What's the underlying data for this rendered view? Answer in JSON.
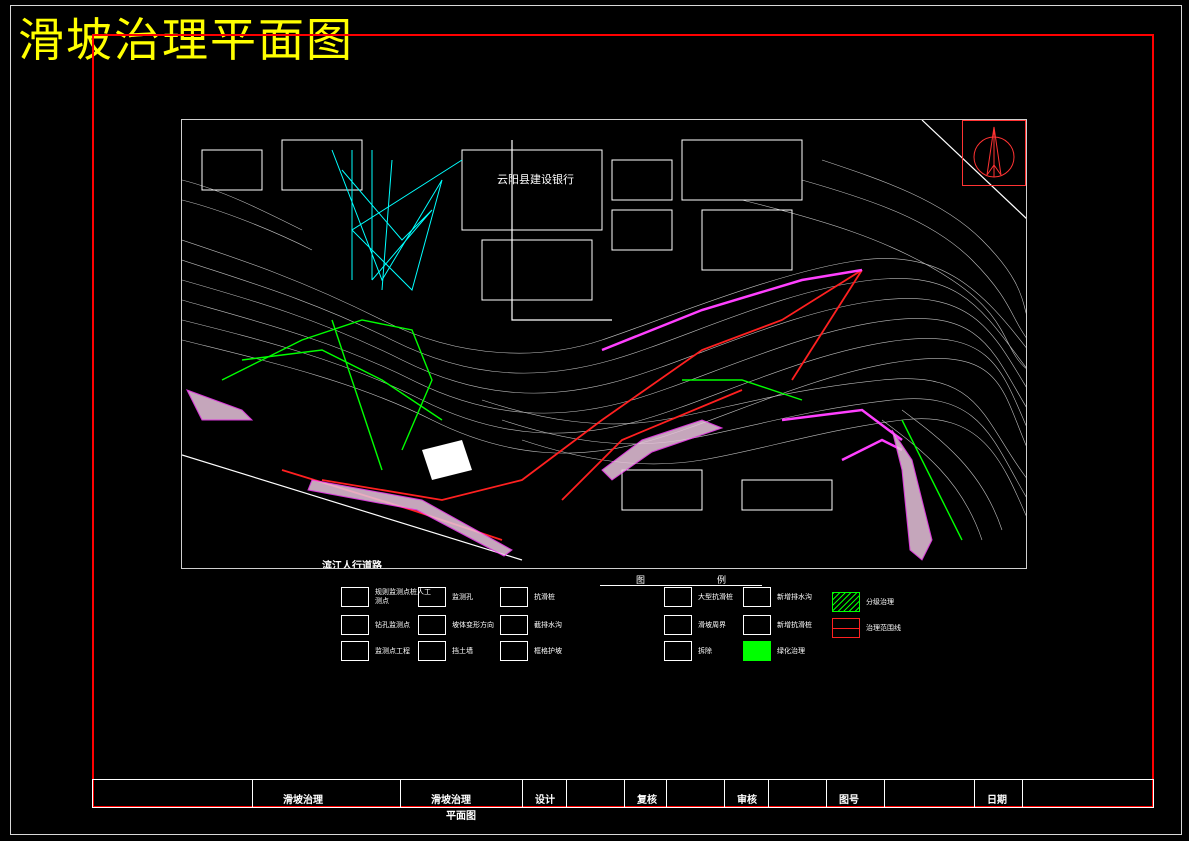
{
  "title": "滑坡治理平面图",
  "map": {
    "bank_label": "云阳县建设银行",
    "road_label": "滨江人行道路"
  },
  "legend": {
    "title_a": "图",
    "title_b": "例",
    "items": [
      {
        "text": "规则监测点桩人工测点"
      },
      {
        "text": "钻孔监测点"
      },
      {
        "text": "监测点工程"
      },
      {
        "text": "监测孔"
      },
      {
        "text": "坡体变形方向"
      },
      {
        "text": "挡土墙"
      },
      {
        "text": "抗滑桩"
      },
      {
        "text": "截排水沟"
      },
      {
        "text": "框格护坡"
      },
      {
        "text": "大型抗滑桩"
      },
      {
        "text": "滑坡周界"
      },
      {
        "text": "拆除"
      },
      {
        "text": "新增排水沟"
      },
      {
        "text": "新增抗滑桩"
      },
      {
        "text": "绿化治理"
      },
      {
        "text": "分级治理"
      },
      {
        "text": "治理范围线"
      }
    ]
  },
  "title_block": {
    "project": "滑坡治理",
    "drawing": "滑坡治理",
    "drawing_sub": "平面图",
    "design": "设计",
    "review": "复核",
    "approve": "审核",
    "number": "图号",
    "date": "日期"
  },
  "colors": {
    "title": "#ffff00",
    "frame": "#ff0000",
    "contours": "#ffffff",
    "survey": "#00ffff",
    "drainage": "#00ff00",
    "anchor": "#ff00ff"
  }
}
